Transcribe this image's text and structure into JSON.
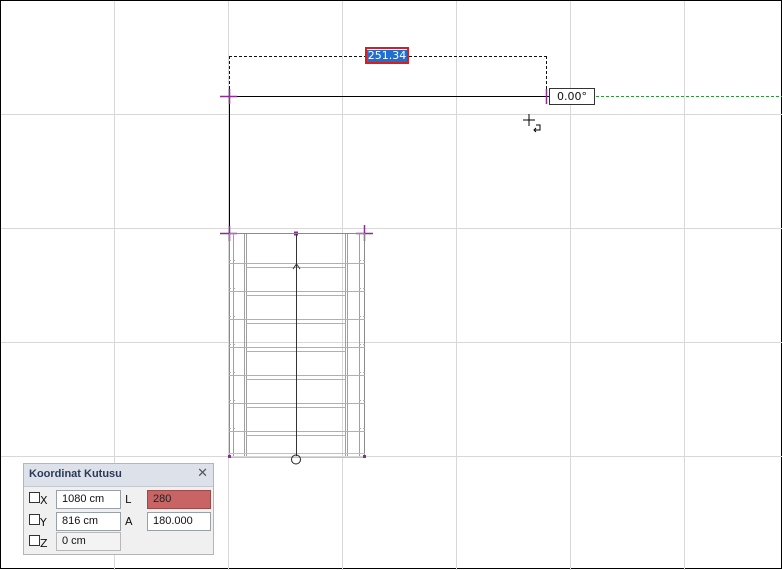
{
  "drawing": {
    "dimension_value": "251.34",
    "angle_value": "0.00°"
  },
  "coord_panel": {
    "title": "Koordinat Kutusu",
    "close_glyph": "✕",
    "rows": [
      {
        "axis": "X",
        "value": "1080 cm",
        "param_label": "L",
        "param_value": "280"
      },
      {
        "axis": "Y",
        "value": "816 cm",
        "param_label": "A",
        "param_value": "180.000"
      },
      {
        "axis": "Z",
        "value": "0 cm"
      }
    ]
  },
  "colors": {
    "grid": "#d8d8d8",
    "line": "#000000",
    "handle": "#8a2b96",
    "guide": "#2a9a3a",
    "input_border": "#d81e1e",
    "selection": "#1f6fd1",
    "highlight_field": "#c86464"
  }
}
